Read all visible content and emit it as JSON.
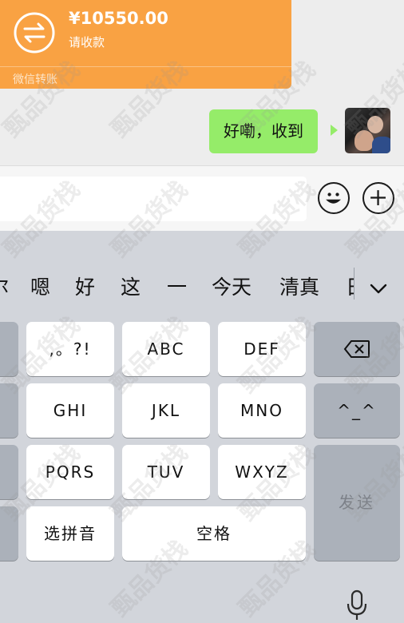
{
  "transfer": {
    "amount": "¥10550.00",
    "status": "请收款",
    "footer": "微信转账"
  },
  "message": {
    "text": "好嘞，收到"
  },
  "input": {
    "value": ""
  },
  "candidates": [
    "尔",
    "嗯",
    "好",
    "这",
    "一",
    "今天",
    "清真",
    "日"
  ],
  "keys": {
    "punct": ",。?!",
    "abc": "ABC",
    "def": "DEF",
    "ghi": "GHI",
    "jkl": "JKL",
    "mno": "MNO",
    "emoticon": "^_^",
    "pqrs": "PQRS",
    "tuv": "TUV",
    "wxyz": "WXYZ",
    "send": "发送",
    "pinyin": "选拼音",
    "space": "空格"
  },
  "watermark": "甄品货栈",
  "colors": {
    "transfer_card": "#f9a243",
    "bubble": "#95ec69",
    "keyboard_bg": "#d2d5db"
  }
}
